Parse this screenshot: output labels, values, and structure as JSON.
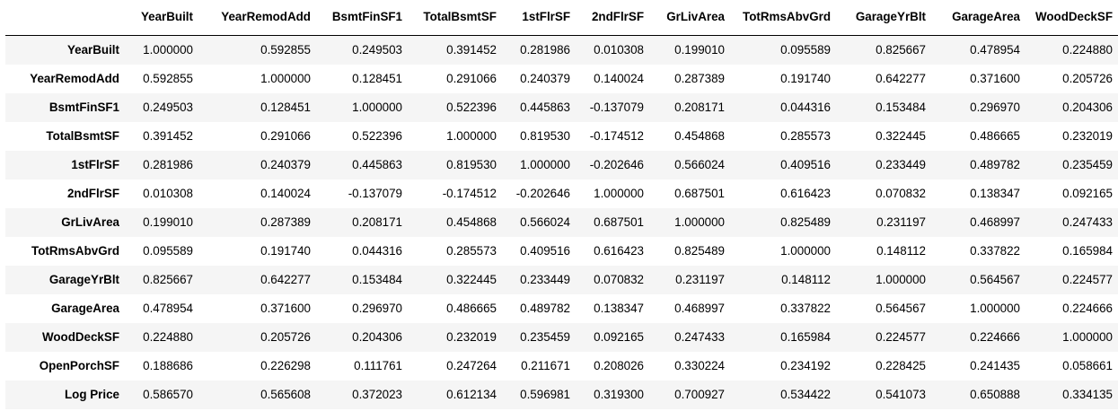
{
  "table": {
    "corner": "",
    "columns": [
      "YearBuilt",
      "YearRemodAdd",
      "BsmtFinSF1",
      "TotalBsmtSF",
      "1stFlrSF",
      "2ndFlrSF",
      "GrLivArea",
      "TotRmsAbvGrd",
      "GarageYrBlt",
      "GarageArea",
      "WoodDeckSF"
    ],
    "rows": [
      {
        "label": "YearBuilt",
        "values": [
          "1.000000",
          "0.592855",
          "0.249503",
          "0.391452",
          "0.281986",
          "0.010308",
          "0.199010",
          "0.095589",
          "0.825667",
          "0.478954",
          "0.224880"
        ]
      },
      {
        "label": "YearRemodAdd",
        "values": [
          "0.592855",
          "1.000000",
          "0.128451",
          "0.291066",
          "0.240379",
          "0.140024",
          "0.287389",
          "0.191740",
          "0.642277",
          "0.371600",
          "0.205726"
        ]
      },
      {
        "label": "BsmtFinSF1",
        "values": [
          "0.249503",
          "0.128451",
          "1.000000",
          "0.522396",
          "0.445863",
          "-0.137079",
          "0.208171",
          "0.044316",
          "0.153484",
          "0.296970",
          "0.204306"
        ]
      },
      {
        "label": "TotalBsmtSF",
        "values": [
          "0.391452",
          "0.291066",
          "0.522396",
          "1.000000",
          "0.819530",
          "-0.174512",
          "0.454868",
          "0.285573",
          "0.322445",
          "0.486665",
          "0.232019"
        ]
      },
      {
        "label": "1stFlrSF",
        "values": [
          "0.281986",
          "0.240379",
          "0.445863",
          "0.819530",
          "1.000000",
          "-0.202646",
          "0.566024",
          "0.409516",
          "0.233449",
          "0.489782",
          "0.235459"
        ]
      },
      {
        "label": "2ndFlrSF",
        "values": [
          "0.010308",
          "0.140024",
          "-0.137079",
          "-0.174512",
          "-0.202646",
          "1.000000",
          "0.687501",
          "0.616423",
          "0.070832",
          "0.138347",
          "0.092165"
        ]
      },
      {
        "label": "GrLivArea",
        "values": [
          "0.199010",
          "0.287389",
          "0.208171",
          "0.454868",
          "0.566024",
          "0.687501",
          "1.000000",
          "0.825489",
          "0.231197",
          "0.468997",
          "0.247433"
        ]
      },
      {
        "label": "TotRmsAbvGrd",
        "values": [
          "0.095589",
          "0.191740",
          "0.044316",
          "0.285573",
          "0.409516",
          "0.616423",
          "0.825489",
          "1.000000",
          "0.148112",
          "0.337822",
          "0.165984"
        ]
      },
      {
        "label": "GarageYrBlt",
        "values": [
          "0.825667",
          "0.642277",
          "0.153484",
          "0.322445",
          "0.233449",
          "0.070832",
          "0.231197",
          "0.148112",
          "1.000000",
          "0.564567",
          "0.224577"
        ]
      },
      {
        "label": "GarageArea",
        "values": [
          "0.478954",
          "0.371600",
          "0.296970",
          "0.486665",
          "0.489782",
          "0.138347",
          "0.468997",
          "0.337822",
          "0.564567",
          "1.000000",
          "0.224666"
        ]
      },
      {
        "label": "WoodDeckSF",
        "values": [
          "0.224880",
          "0.205726",
          "0.204306",
          "0.232019",
          "0.235459",
          "0.092165",
          "0.247433",
          "0.165984",
          "0.224577",
          "0.224666",
          "1.000000"
        ]
      },
      {
        "label": "OpenPorchSF",
        "values": [
          "0.188686",
          "0.226298",
          "0.111761",
          "0.247264",
          "0.211671",
          "0.208026",
          "0.330224",
          "0.234192",
          "0.228425",
          "0.241435",
          "0.058661"
        ]
      },
      {
        "label": "Log Price",
        "values": [
          "0.586570",
          "0.565608",
          "0.372023",
          "0.612134",
          "0.596981",
          "0.319300",
          "0.700927",
          "0.534422",
          "0.541073",
          "0.650888",
          "0.334135"
        ]
      }
    ],
    "colors": {
      "stripe": "#f5f5f5",
      "header_rule": "#000000",
      "text": "#000000"
    }
  }
}
